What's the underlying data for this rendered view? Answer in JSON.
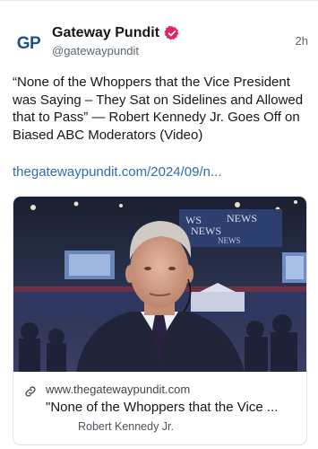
{
  "post": {
    "avatar_text": "GP",
    "display_name": "Gateway Pundit",
    "handle": "@gatewaypundit",
    "timestamp": "2h",
    "text": "“None of the Whoppers that the Vice President was Saying – They Sat on Sidelines and Allowed that to Pass” — Robert Kennedy Jr. Goes Off on Biased ABC Moderators (Video)",
    "link_text": "thegatewaypundit.com/2024/09/n..."
  },
  "card": {
    "domain": "www.thegatewaypundit.com",
    "title": "\"None of the Whoppers that the Vice ...",
    "description": "Robert Kennedy Jr.",
    "backdrop_words": [
      "WS",
      "NEWS",
      "NEWS",
      "NEWS"
    ]
  },
  "icons": {
    "verified": "verified-badge-icon",
    "link": "link-icon"
  },
  "colors": {
    "accent": "#2a6db5",
    "verified_badge": "#e0245e",
    "avatar_text": "#1f4f8f"
  }
}
